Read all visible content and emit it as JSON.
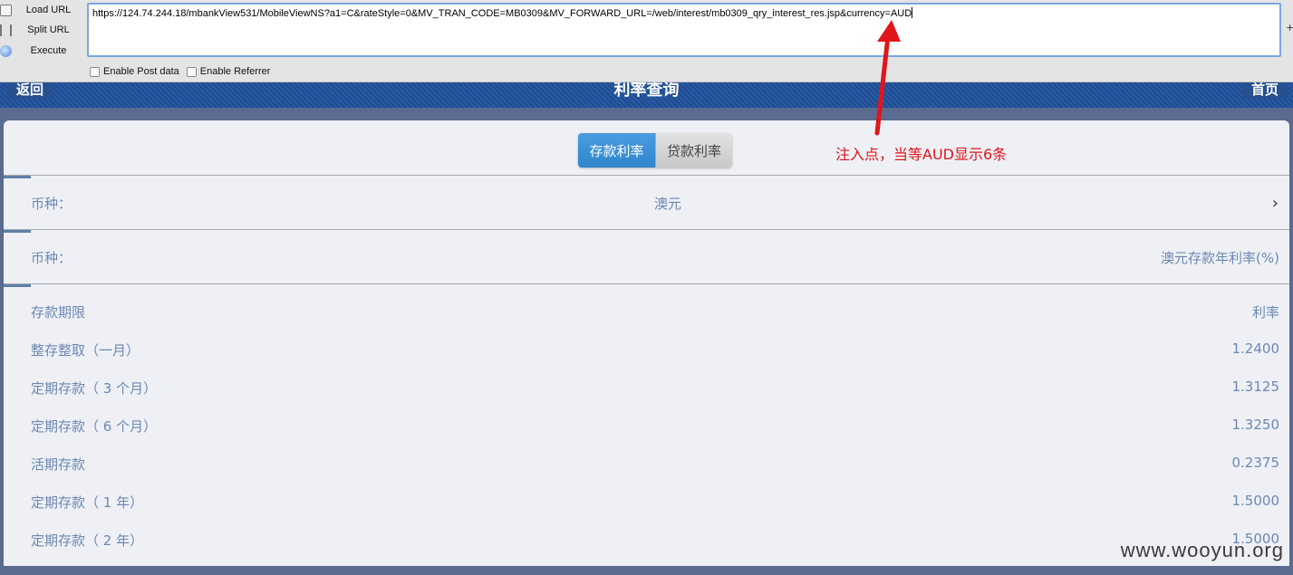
{
  "toolbar": {
    "load_url": "Load URL",
    "split_url": "Split URL",
    "execute": "Execute",
    "url": "https://124.74.244.18/mbankView531/MobileViewNS?a1=C&rateStyle=0&MV_TRAN_CODE=MB0309&MV_FORWARD_URL=/web/interest/mb0309_qry_interest_res.jsp&currency=AUD",
    "enable_post": "Enable Post data",
    "enable_referrer": "Enable Referrer",
    "plus": "+"
  },
  "header": {
    "back": "返回",
    "title": "利率查询",
    "home": "首页"
  },
  "tabs": {
    "deposit": "存款利率",
    "loan": "贷款利率"
  },
  "annotation": "注入点，当等AUD显示6条",
  "currency_row": {
    "label": "币种：",
    "value": "澳元"
  },
  "rate_header_row": {
    "label": "币种：",
    "value": "澳元存款年利率(%)"
  },
  "table": {
    "col_term": "存款期限",
    "col_rate": "利率",
    "rows": [
      {
        "term": "整存整取（一月）",
        "rate": "1.2400"
      },
      {
        "term": "定期存款（ 3 个月）",
        "rate": "1.3125"
      },
      {
        "term": "定期存款（ 6 个月）",
        "rate": "1.3250"
      },
      {
        "term": "活期存款",
        "rate": "0.2375"
      },
      {
        "term": "定期存款（ 1 年）",
        "rate": "1.5000"
      },
      {
        "term": "定期存款（ 2 年）",
        "rate": "1.5000"
      }
    ]
  },
  "watermark": "www.wooyun.org",
  "colors": {
    "accent_blue": "#2f84cc",
    "text_blue": "#6c88b4",
    "annotation_red": "#e0161b"
  }
}
